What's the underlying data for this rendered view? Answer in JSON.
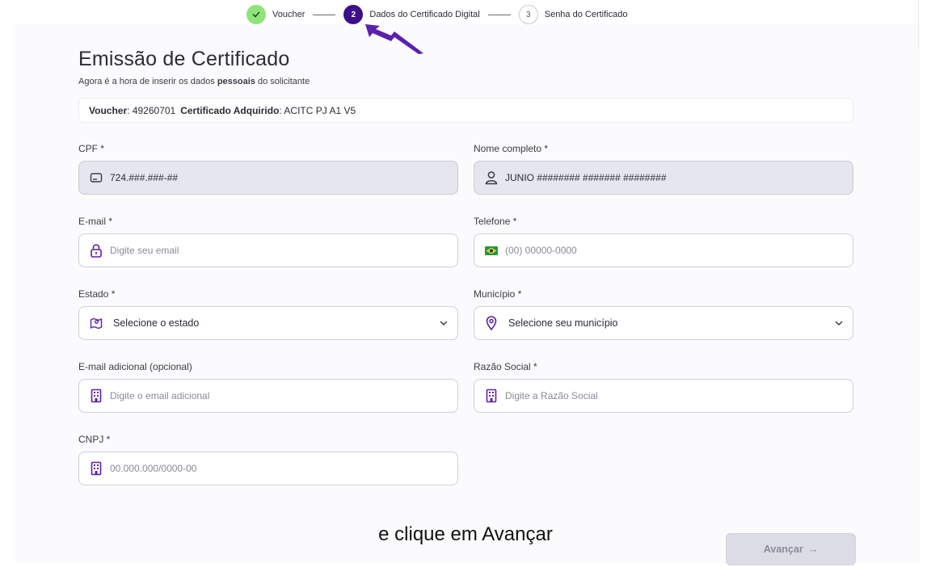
{
  "stepper": {
    "steps": [
      {
        "number": "",
        "label": "Voucher",
        "state": "done"
      },
      {
        "number": "2",
        "label": "Dados do Certificado Digital",
        "state": "active"
      },
      {
        "number": "3",
        "label": "Senha do Certificado",
        "state": "todo"
      }
    ]
  },
  "header": {
    "title": "Emissão de Certificado",
    "subtitle_before": "Agora é a hora de inserir os dados ",
    "subtitle_bold": "pessoais",
    "subtitle_after": " do solicitante"
  },
  "voucher": {
    "voucher_label": "Voucher",
    "voucher_value": ": 49260701",
    "certificate_label": "Certificado Adquirido",
    "certificate_value": ": ACITC PJ A1 V5"
  },
  "form": {
    "cpf": {
      "label": "CPF *",
      "value": "724.###.###-##"
    },
    "nome": {
      "label": "Nome completo *",
      "value": "JUNIO ######## ####### ########"
    },
    "email": {
      "label": "E-mail *",
      "placeholder": "Digite seu email"
    },
    "telefone": {
      "label": "Telefone *",
      "placeholder": "(00) 00000-0000"
    },
    "estado": {
      "label": "Estado *",
      "value": "Selecione o estado"
    },
    "municipio": {
      "label": "Município *",
      "value": "Selecione seu município"
    },
    "email_adicional": {
      "label": "E-mail adicional (opcional)",
      "placeholder": "Digite o email adicional"
    },
    "razao_social": {
      "label": "Razão Social *",
      "placeholder": "Digite a Razão Social"
    },
    "cnpj": {
      "label": "CNPJ *",
      "placeholder": "00.000.000/0000-00"
    }
  },
  "caption": "e clique em Avançar",
  "actions": {
    "next_label": "Avançar",
    "next_arrow": "→"
  },
  "colors": {
    "accent": "#5b1fb0",
    "accent_dark": "#3d0e8a",
    "done": "#8ee37a",
    "disabled_bg": "#e6e6ee"
  }
}
